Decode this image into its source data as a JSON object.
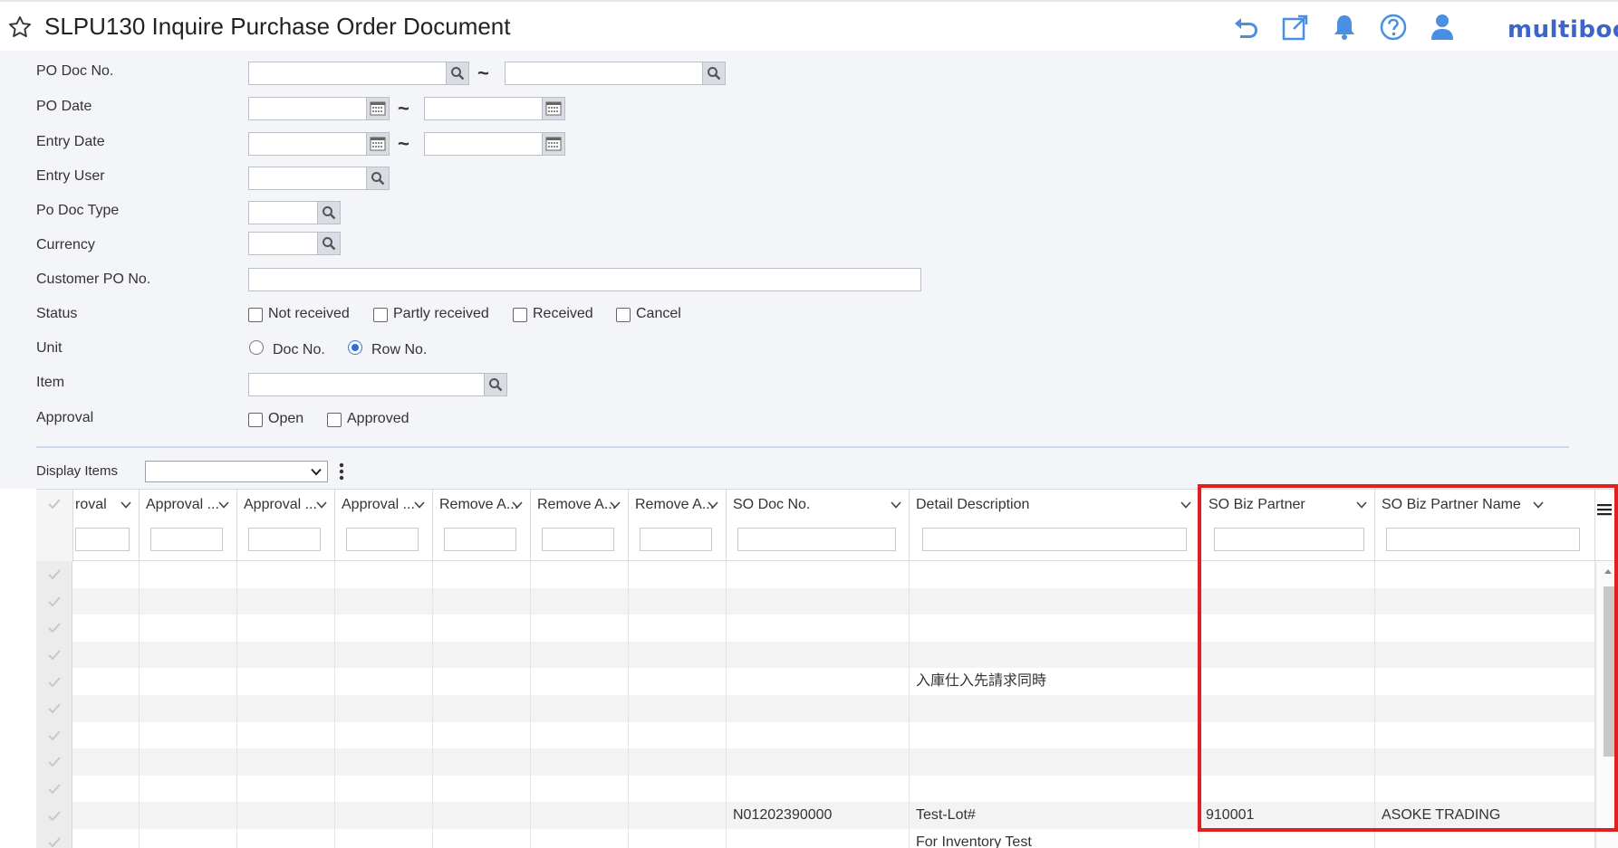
{
  "header": {
    "title": "SLPU130 Inquire Purchase Order Document",
    "brand": "multibook",
    "icons": [
      "star-icon",
      "undo-icon",
      "popout-icon",
      "bell-icon",
      "help-icon",
      "user-icon"
    ],
    "accent": "#3d64c8",
    "icon_color": "#4a90e2"
  },
  "form": {
    "po_doc_no": {
      "label": "PO Doc No.",
      "from": "",
      "to": "",
      "range_sep": "~"
    },
    "po_date": {
      "label": "PO Date",
      "from": "",
      "to": "",
      "range_sep": "~"
    },
    "entry_date": {
      "label": "Entry Date",
      "from": "",
      "to": "",
      "range_sep": "~"
    },
    "entry_user": {
      "label": "Entry User",
      "value": ""
    },
    "po_doc_type": {
      "label": "Po Doc Type",
      "value": ""
    },
    "currency": {
      "label": "Currency",
      "value": ""
    },
    "customer_po_no": {
      "label": "Customer PO No.",
      "value": ""
    },
    "status": {
      "label": "Status",
      "options": [
        {
          "label": "Not received",
          "checked": false
        },
        {
          "label": "Partly received",
          "checked": false
        },
        {
          "label": "Received",
          "checked": false
        },
        {
          "label": "Cancel",
          "checked": false
        }
      ]
    },
    "unit": {
      "label": "Unit",
      "options": [
        {
          "label": "Doc No.",
          "selected": false
        },
        {
          "label": "Row No.",
          "selected": true
        }
      ]
    },
    "item": {
      "label": "Item",
      "value": ""
    },
    "approval": {
      "label": "Approval",
      "options": [
        {
          "label": "Open",
          "checked": false
        },
        {
          "label": "Approved",
          "checked": false
        }
      ]
    }
  },
  "display_items": {
    "label": "Display Items",
    "value": ""
  },
  "grid": {
    "columns": [
      {
        "label": "roval"
      },
      {
        "label": "Approval ..."
      },
      {
        "label": "Approval ..."
      },
      {
        "label": "Approval ..."
      },
      {
        "label": "Remove A..."
      },
      {
        "label": "Remove A..."
      },
      {
        "label": "Remove A..."
      },
      {
        "label": "SO Doc No."
      },
      {
        "label": "Detail Description"
      },
      {
        "label": "SO Biz Partner"
      },
      {
        "label": "SO Biz Partner Name"
      }
    ],
    "rows": [
      [
        "",
        "",
        "",
        "",
        "",
        "",
        "",
        "",
        "",
        "",
        ""
      ],
      [
        "",
        "",
        "",
        "",
        "",
        "",
        "",
        "",
        "",
        "",
        ""
      ],
      [
        "",
        "",
        "",
        "",
        "",
        "",
        "",
        "",
        "",
        "",
        ""
      ],
      [
        "",
        "",
        "",
        "",
        "",
        "",
        "",
        "",
        "",
        "",
        ""
      ],
      [
        "",
        "",
        "",
        "",
        "",
        "",
        "",
        "",
        "入庫仕入先請求同時",
        "",
        ""
      ],
      [
        "",
        "",
        "",
        "",
        "",
        "",
        "",
        "",
        "",
        "",
        ""
      ],
      [
        "",
        "",
        "",
        "",
        "",
        "",
        "",
        "",
        "",
        "",
        ""
      ],
      [
        "",
        "",
        "",
        "",
        "",
        "",
        "",
        "",
        "",
        "",
        ""
      ],
      [
        "",
        "",
        "",
        "",
        "",
        "",
        "",
        "",
        "",
        "",
        ""
      ],
      [
        "",
        "",
        "",
        "",
        "",
        "",
        "",
        "N01202390000",
        "Test-Lot#",
        "910001",
        "ASOKE TRADING"
      ],
      [
        "",
        "",
        "",
        "",
        "",
        "",
        "",
        "",
        "For Inventory Test",
        "",
        ""
      ]
    ]
  }
}
